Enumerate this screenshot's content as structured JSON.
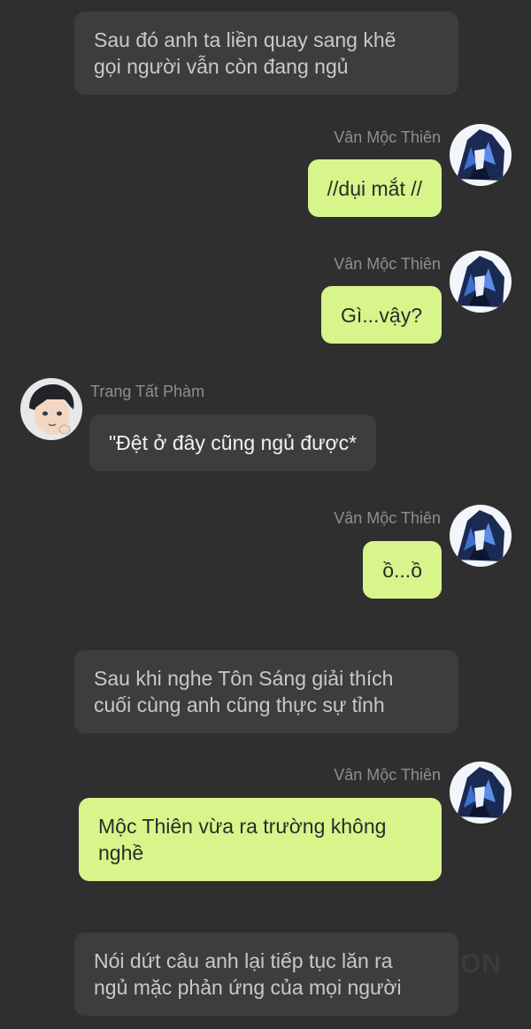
{
  "messages": [
    {
      "type": "narration",
      "text_lines": [
        "Sau đó anh ta liền quay sang khẽ",
        "gọi người vẫn còn đang ngủ"
      ]
    },
    {
      "type": "outgoing",
      "sender": "Vân Mộc Thiên",
      "text": "//dụi mắt //"
    },
    {
      "type": "outgoing",
      "sender": "Vân Mộc Thiên",
      "text": "Gì...vậy?"
    },
    {
      "type": "incoming",
      "sender": "Trang Tất Phàm",
      "text": "\"Đệt ở đây cũng ngủ được*"
    },
    {
      "type": "outgoing",
      "sender": "Vân Mộc Thiên",
      "text": "ồ...ồ"
    },
    {
      "type": "narration",
      "text_lines": [
        "Sau khi nghe Tôn Sáng giải thích",
        "cuối cùng anh cũng thực sự tỉnh"
      ]
    },
    {
      "type": "outgoing",
      "sender": "Vân Mộc Thiên",
      "text_lines": [
        "Mộc Thiên vừa ra trường không",
        "nghề"
      ]
    },
    {
      "type": "narration",
      "text_lines": [
        "Nói dứt câu anh lại tiếp tục lăn ra",
        "ngủ mặc phản ứng của mọi người"
      ]
    }
  ],
  "avatars": {
    "van_moc_thien": "anime-avatar-blue-hair",
    "trang_tat_pham": "anime-avatar-dark-hair"
  },
  "watermark": "ON",
  "colors": {
    "background": "#2f2f2f",
    "narration_bubble": "#3d3d3d",
    "outgoing_bubble": "#d7f58a",
    "sender_name": "#8f8f8f"
  }
}
